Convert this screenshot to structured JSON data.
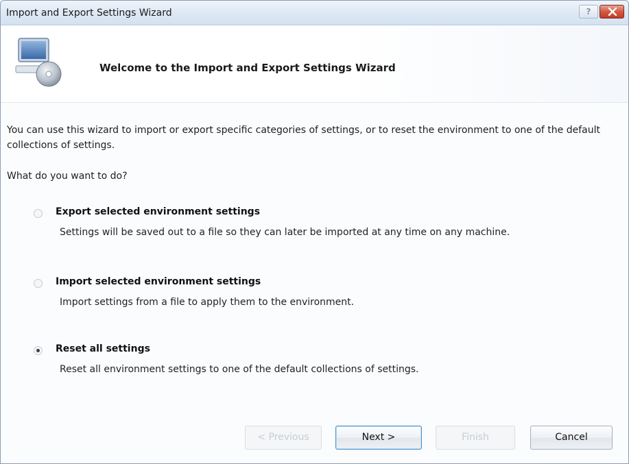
{
  "window": {
    "title": "Import and Export Settings Wizard",
    "help_label": "?"
  },
  "header": {
    "title": "Welcome to the Import and Export Settings Wizard"
  },
  "content": {
    "intro": "You can use this wizard to import or export specific categories of settings, or to reset the environment to one of the default collections of settings.",
    "question": "What do you want to do?"
  },
  "options": [
    {
      "label": "Export selected environment settings",
      "description": "Settings will be saved out to a file so they can later be imported at any time on any machine.",
      "selected": false
    },
    {
      "label": "Import selected environment settings",
      "description": "Import settings from a file to apply them to the environment.",
      "selected": false
    },
    {
      "label": "Reset all settings",
      "description": "Reset all environment settings to one of the default collections of settings.",
      "selected": true
    }
  ],
  "buttons": {
    "previous": "< Previous",
    "next": "Next >",
    "finish": "Finish",
    "cancel": "Cancel"
  },
  "colors": {
    "titlebar": "#dde8f4",
    "close_button": "#c43b24",
    "default_button_border": "#4f8fc9"
  }
}
